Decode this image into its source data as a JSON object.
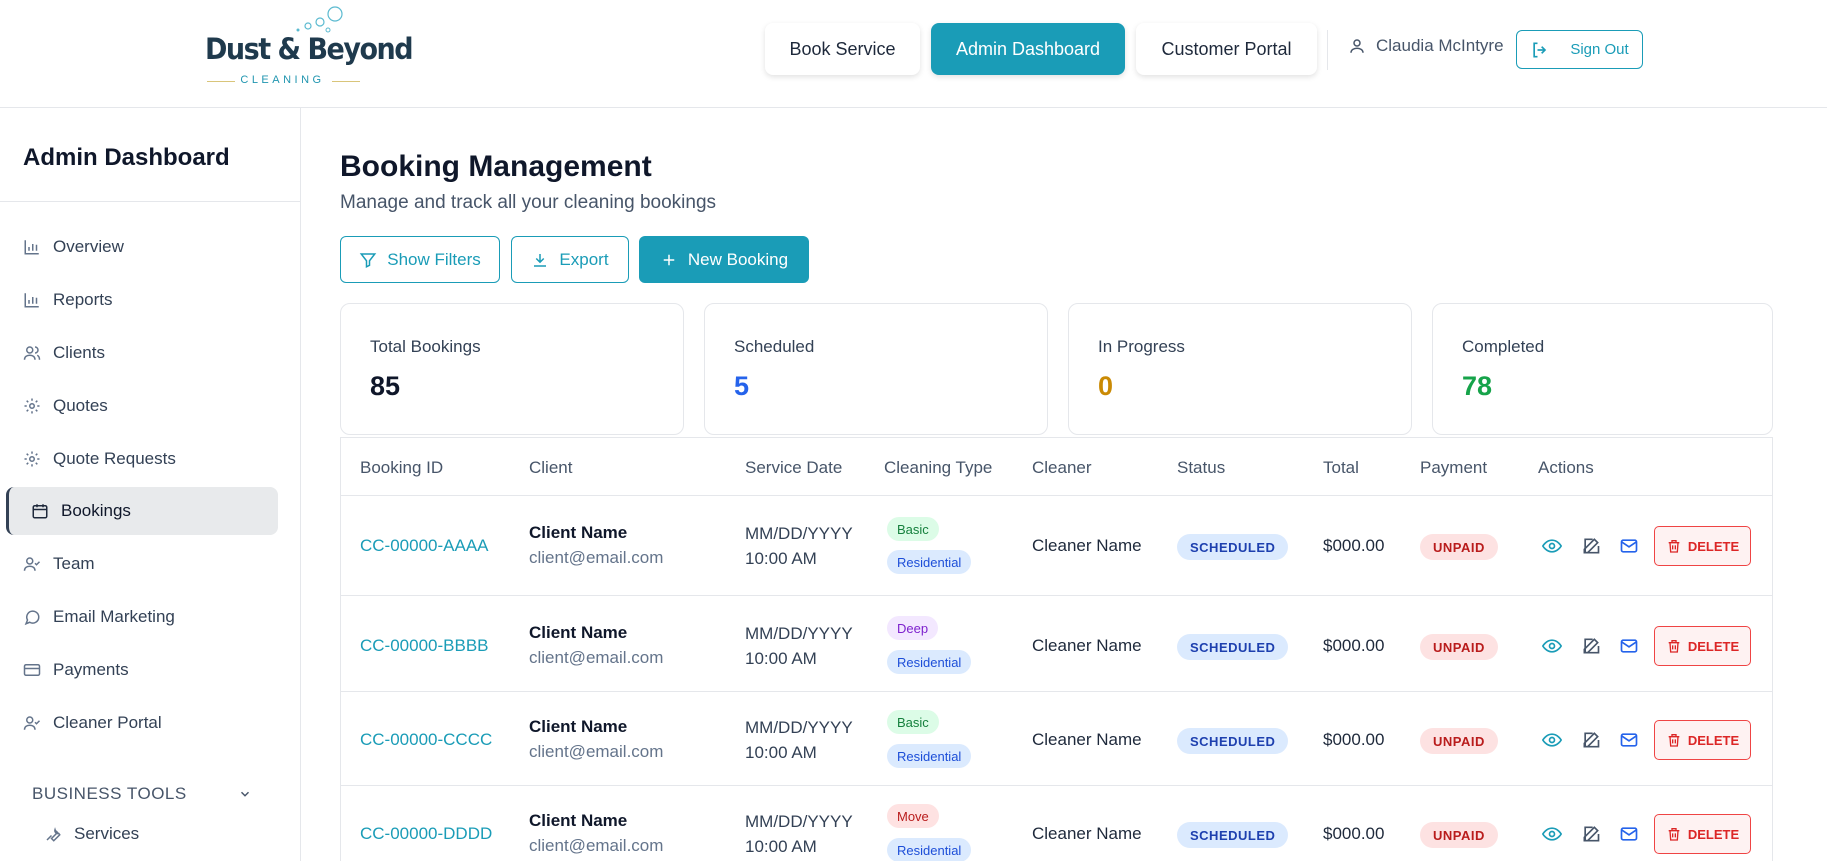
{
  "brand": {
    "name": "Dust & Beyond",
    "tagline": "CLEANING"
  },
  "nav": {
    "book_service": "Book Service",
    "admin_dashboard": "Admin Dashboard",
    "customer_portal": "Customer Portal",
    "user_name": "Claudia McIntyre",
    "sign_out": "Sign Out"
  },
  "sidebar": {
    "title": "Admin Dashboard",
    "items": [
      {
        "label": "Overview",
        "icon": "bar-chart-icon"
      },
      {
        "label": "Reports",
        "icon": "bar-chart-icon"
      },
      {
        "label": "Clients",
        "icon": "users-icon"
      },
      {
        "label": "Quotes",
        "icon": "gear-icon"
      },
      {
        "label": "Quote Requests",
        "icon": "gear-icon"
      },
      {
        "label": "Bookings",
        "icon": "calendar-icon",
        "active": true
      },
      {
        "label": "Team",
        "icon": "user-check-icon"
      },
      {
        "label": "Email Marketing",
        "icon": "chat-icon"
      },
      {
        "label": "Payments",
        "icon": "credit-card-icon"
      },
      {
        "label": "Cleaner Portal",
        "icon": "user-check-icon"
      }
    ],
    "section": "BUSINESS TOOLS",
    "sub_item": "Services"
  },
  "main": {
    "title": "Booking Management",
    "subtitle": "Manage and track all your cleaning bookings",
    "actions": {
      "filters": "Show Filters",
      "export": "Export",
      "new_booking": "New Booking"
    }
  },
  "stats": [
    {
      "label": "Total Bookings",
      "value": "85",
      "color": "#0f172a"
    },
    {
      "label": "Scheduled",
      "value": "5",
      "color": "#2563eb"
    },
    {
      "label": "In Progress",
      "value": "0",
      "color": "#ca8a04"
    },
    {
      "label": "Completed",
      "value": "78",
      "color": "#16a34a"
    }
  ],
  "table": {
    "columns": [
      "Booking ID",
      "Client",
      "Service Date",
      "Cleaning Type",
      "Cleaner",
      "Status",
      "Total",
      "Payment",
      "Actions"
    ],
    "delete_label": "DELETE",
    "rows": [
      {
        "id": "CC-00000-AAAA",
        "client": "Client Name",
        "email": "client@email.com",
        "date": "MM/DD/YYYY",
        "time": "10:00 AM",
        "type": "Basic",
        "category": "Residential",
        "cleaner": "Cleaner Name",
        "status": "SCHEDULED",
        "total": "$000.00",
        "payment": "UNPAID"
      },
      {
        "id": "CC-00000-BBBB",
        "client": "Client Name",
        "email": "client@email.com",
        "date": "MM/DD/YYYY",
        "time": "10:00 AM",
        "type": "Deep",
        "category": "Residential",
        "cleaner": "Cleaner Name",
        "status": "SCHEDULED",
        "total": "$000.00",
        "payment": "UNPAID"
      },
      {
        "id": "CC-00000-CCCC",
        "client": "Client Name",
        "email": "client@email.com",
        "date": "MM/DD/YYYY",
        "time": "10:00 AM",
        "type": "Basic",
        "category": "Residential",
        "cleaner": "Cleaner Name",
        "status": "SCHEDULED",
        "total": "$000.00",
        "payment": "UNPAID"
      },
      {
        "id": "CC-00000-DDDD",
        "client": "Client Name",
        "email": "client@email.com",
        "date": "MM/DD/YYYY",
        "time": "10:00 AM",
        "type": "Move",
        "category": "Residential",
        "cleaner": "Cleaner Name",
        "status": "SCHEDULED",
        "total": "$000.00",
        "payment": "UNPAID"
      }
    ]
  },
  "colors": {
    "accent": "#1a9cb7",
    "danger": "#dc2626"
  }
}
